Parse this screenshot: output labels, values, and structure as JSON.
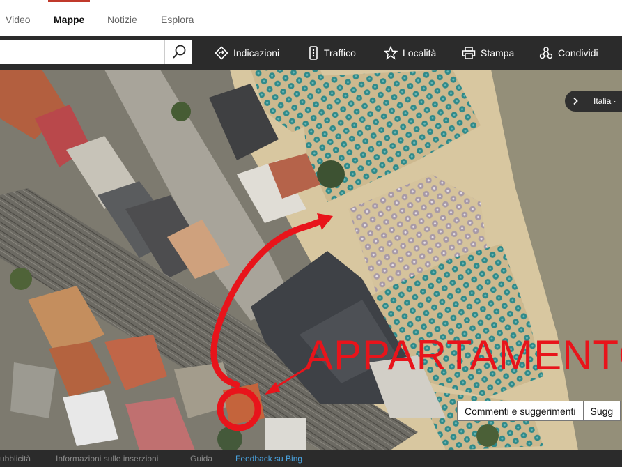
{
  "nav": {
    "tabs": [
      {
        "label": "Video"
      },
      {
        "label": "Mappe"
      },
      {
        "label": "Notizie"
      },
      {
        "label": "Esplora"
      }
    ]
  },
  "toolbar": {
    "search_value": "",
    "items": [
      {
        "label": "Indicazioni",
        "icon": "directions-icon"
      },
      {
        "label": "Traffico",
        "icon": "traffic-icon"
      },
      {
        "label": "Località",
        "icon": "star-icon"
      },
      {
        "label": "Stampa",
        "icon": "printer-icon"
      },
      {
        "label": "Condividi",
        "icon": "share-icon"
      }
    ]
  },
  "map": {
    "region_label": "Italia ·",
    "annotation_text": "APPARTAMENTO",
    "annotation_color": "#e8141b",
    "feedback_buttons": [
      {
        "label": "Commenti e suggerimenti"
      },
      {
        "label": "Sugg"
      }
    ]
  },
  "footer": {
    "links": [
      {
        "label": "ubblicità"
      },
      {
        "label": "Informazioni sulle inserzioni"
      },
      {
        "label": "Guida"
      },
      {
        "label": "Feedback su Bing"
      }
    ]
  }
}
